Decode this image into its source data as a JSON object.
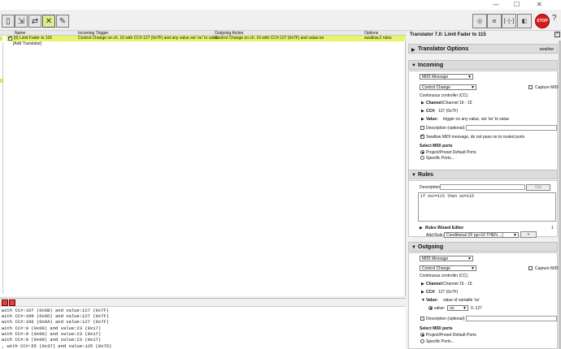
{
  "window": {
    "minimize": "—",
    "maximize": "☐",
    "close": "✕"
  },
  "toolbar": {
    "stop_label": "STOP",
    "right_buttons": [
      "",
      "",
      "[-|-]",
      ""
    ],
    "help": "?"
  },
  "table": {
    "headers": [
      "Name",
      "Incoming Trigger",
      "Outgoing Action",
      "Options"
    ],
    "rows": [
      {
        "name": "[0] Limit Fader to 115",
        "incoming": "Control Change on ch. 16 with CC#:127 (0x7F) and any value set 'oo' to value",
        "outgoing": "Control Change on ch. 16 with CC#:127 (0x7F) and value:oo",
        "options": "swallow,2 rules"
      }
    ],
    "add_label": "[Add Translator]"
  },
  "console": {
    "lines": [
      "with CC#:107 (0x6B) and value:127 (0x7F)",
      "with CC#:109 (0x6D) and value:127 (0x7F)",
      "with CC#:106 (0x6A) and value:127 (0x7F)",
      "with CC#:9 (0x09) and value:23 (0x17)",
      "with CC#:9 (0x09) and value:23 (0x17)",
      "with CC#:9 (0x09) and value:23 (0x17)",
      ", with CC#:55 (0x37) and value:125 (0x7D)"
    ]
  },
  "panel": {
    "title": "Translator 7.0: Limit Fader to 115",
    "close": "×",
    "translator_options": {
      "label": "Translator Options",
      "extra": "swallow"
    },
    "incoming": {
      "label": "Incoming",
      "type": "MIDI Message",
      "msg_type": "Control Change",
      "capture": "Capture MIDI",
      "desc": "Continuous controller (CC).",
      "channel_label": "Channel:",
      "channel_value": "Channel 16  -  15",
      "cc_label": "CC#:",
      "cc_value": "127 (0x7F)",
      "value_label": "Value:",
      "value_value": "trigger on any value, set 'oo' to value",
      "description_label": "Description (optional):",
      "swallow": "Swallow MIDI message, do not pass on to routed ports",
      "ports_label": "Select MIDI ports",
      "port_default": "Project/Preset Default Ports",
      "port_specific": "Specific Ports..."
    },
    "rules": {
      "label": "Rules",
      "description_label": "Description:",
      "del": "Del",
      "code": "if oo>=115 then oo=115",
      "wizard": "Rules Wizard Editor",
      "wizard_count": "1",
      "add_rule_label": "Add Rule:",
      "add_rule_value": "Conditional (IF pp>10 THEN ...)",
      "plus": "+"
    },
    "outgoing": {
      "label": "Outgoing",
      "type": "MIDI Message",
      "msg_type": "Control Change",
      "capture": "Capture MIDI",
      "desc": "Continuous controller (CC).",
      "channel_label": "Channel:",
      "channel_value": "Channel 16  -  15",
      "cc_label": "CC#:",
      "cc_value": "127 (0x7F)",
      "value_label": "Value:",
      "value_value": "value of variable 'oo'",
      "value_radio": "value:",
      "value_var": "oo",
      "value_range": "0..127",
      "description_label": "Description (optional):",
      "ports_label": "Select MIDI ports",
      "port_default": "Project/Preset Default Ports",
      "port_specific": "Specific Ports..."
    }
  }
}
